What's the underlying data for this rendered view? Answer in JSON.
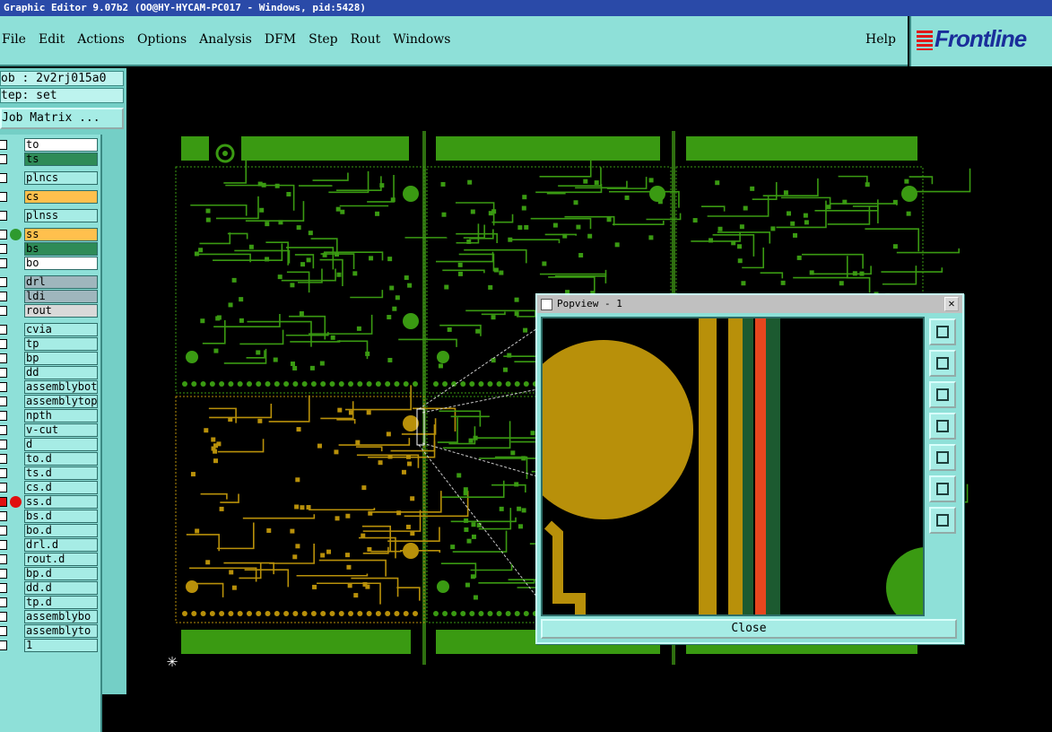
{
  "window": {
    "title": "Graphic Editor 9.07b2 (OO@HY-HYCAM-PC017 - Windows, pid:5428)"
  },
  "menu": {
    "items": [
      "File",
      "Edit",
      "Actions",
      "Options",
      "Analysis",
      "DFM",
      "Step",
      "Rout",
      "Windows"
    ],
    "help": "Help"
  },
  "logo": {
    "text": "Frontline",
    "color": "#1a2e9a"
  },
  "job": {
    "job_label": "ob : 2v2rj015a0",
    "step_label": "tep: set",
    "matrix_button": "Job Matrix ..."
  },
  "layers": [
    {
      "name": "to",
      "bg": "#ffffff"
    },
    {
      "name": "ts",
      "bg": "#2e8b57"
    },
    {
      "name": "plncs",
      "bg": "#a6ece5"
    },
    {
      "name": "cs",
      "bg": "#ffc04d"
    },
    {
      "name": "plnss",
      "bg": "#a6ece5"
    },
    {
      "name": "ss",
      "bg": "#ffc04d",
      "dot": "#2e9a2e",
      "mark": "▣"
    },
    {
      "name": "bs",
      "bg": "#2e8b57"
    },
    {
      "name": "bo",
      "bg": "#ffffff"
    },
    {
      "name": "drl",
      "bg": "#9fb6bd"
    },
    {
      "name": "ldi",
      "bg": "#9fb6bd"
    },
    {
      "name": "rout",
      "bg": "#d9d9d9"
    },
    {
      "name": "cvia",
      "bg": "#a6ece5"
    },
    {
      "name": "tp",
      "bg": "#a6ece5"
    },
    {
      "name": "bp",
      "bg": "#a6ece5"
    },
    {
      "name": "dd",
      "bg": "#a6ece5"
    },
    {
      "name": "assemblybott",
      "bg": "#a6ece5"
    },
    {
      "name": "assemblytop",
      "bg": "#a6ece5"
    },
    {
      "name": "npth",
      "bg": "#a6ece5"
    },
    {
      "name": "v-cut",
      "bg": "#a6ece5"
    },
    {
      "name": "d",
      "bg": "#a6ece5"
    },
    {
      "name": "to.d",
      "bg": "#a6ece5",
      "mark": "✎"
    },
    {
      "name": "ts.d",
      "bg": "#a6ece5"
    },
    {
      "name": "cs.d",
      "bg": "#a6ece5"
    },
    {
      "name": "ss.d",
      "bg": "#a6ece5",
      "dot": "#e01010",
      "check": "#e01010"
    },
    {
      "name": "bs.d",
      "bg": "#a6ece5"
    },
    {
      "name": "bo.d",
      "bg": "#a6ece5",
      "mark": "✎"
    },
    {
      "name": "drl.d",
      "bg": "#a6ece5"
    },
    {
      "name": "rout.d",
      "bg": "#a6ece5"
    },
    {
      "name": "bp.d",
      "bg": "#a6ece5"
    },
    {
      "name": "dd.d",
      "bg": "#a6ece5"
    },
    {
      "name": "tp.d",
      "bg": "#a6ece5"
    },
    {
      "name": "assemblybo",
      "bg": "#a6ece5",
      "mark": "✎"
    },
    {
      "name": "assemblyto",
      "bg": "#a6ece5",
      "mark": "✎"
    },
    {
      "name": "1",
      "bg": "#a6ece5"
    }
  ],
  "popview": {
    "title": "Popview - 1",
    "close_button": "Close",
    "tools": [
      "zoom-window-icon",
      "pan-up-icon",
      "pan-down-icon",
      "pan-left-icon",
      "pan-right-icon",
      "zoom-fit-icon",
      "zoom-center-icon"
    ]
  },
  "colors": {
    "green_layer": "#3a9a12",
    "copper_layer": "#b8900a",
    "orange_layer": "#e6461e",
    "teal": "#8ee0d8"
  }
}
